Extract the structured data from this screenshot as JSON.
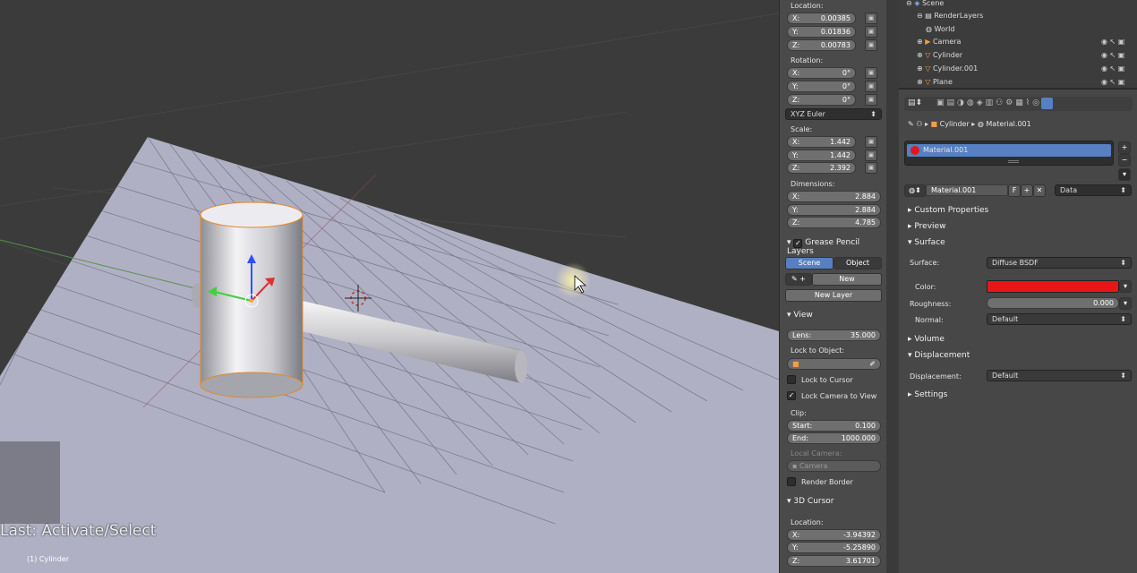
{
  "viewport": {
    "last_op": "Last: Activate/Select",
    "active_object": "(1) Cylinder"
  },
  "npanel": {
    "location_label": "Location:",
    "location": [
      {
        "axis": "X:",
        "value": "0.00385"
      },
      {
        "axis": "Y:",
        "value": "0.01836"
      },
      {
        "axis": "Z:",
        "value": "0.00783"
      }
    ],
    "rotation_label": "Rotation:",
    "rotation": [
      {
        "axis": "X:",
        "value": "0°"
      },
      {
        "axis": "Y:",
        "value": "0°"
      },
      {
        "axis": "Z:",
        "value": "0°"
      }
    ],
    "rotation_mode": "XYZ Euler",
    "scale_label": "Scale:",
    "scale": [
      {
        "axis": "X:",
        "value": "1.442"
      },
      {
        "axis": "Y:",
        "value": "1.442"
      },
      {
        "axis": "Z:",
        "value": "2.392"
      }
    ],
    "dimensions_label": "Dimensions:",
    "dimensions": [
      {
        "axis": "X:",
        "value": "2.884"
      },
      {
        "axis": "Y:",
        "value": "2.884"
      },
      {
        "axis": "Z:",
        "value": "4.785"
      }
    ],
    "grease_title": "Grease Pencil Layers",
    "grease_scene": "Scene",
    "grease_object": "Object",
    "grease_new": "New",
    "grease_new_layer": "New Layer",
    "view_title": "View",
    "lens_label": "Lens:",
    "lens_value": "35.000",
    "lock_to_object": "Lock to Object:",
    "lock_to_cursor": "Lock to Cursor",
    "lock_camera": "Lock Camera to View",
    "clip_label": "Clip:",
    "clip_start_label": "Start:",
    "clip_start": "0.100",
    "clip_end_label": "End:",
    "clip_end": "1000.000",
    "local_camera": "Local Camera:",
    "camera_field": "Camera",
    "render_border": "Render Border",
    "cursor_title": "3D Cursor",
    "cursor_location_label": "Location:",
    "cursor_location": [
      {
        "axis": "X:",
        "value": "-3.94392"
      },
      {
        "axis": "Y:",
        "value": "-5.25890"
      },
      {
        "axis": "Z:",
        "value": "3.61701"
      }
    ]
  },
  "outliner": {
    "items": [
      "Scene",
      "RenderLayers",
      "World",
      "Camera",
      "Cylinder",
      "Cylinder.001",
      "Plane"
    ]
  },
  "properties": {
    "breadcrumb_object": "Cylinder",
    "breadcrumb_material": "Material.001",
    "slot_name": "Material.001",
    "material_field": "Material.001",
    "material_f": "F",
    "link_mode": "Data",
    "sections": {
      "custom": "Custom Properties",
      "preview": "Preview",
      "surface": "Surface",
      "volume": "Volume",
      "displacement": "Displacement",
      "settings": "Settings"
    },
    "surface_label": "Surface:",
    "surface_value": "Diffuse BSDF",
    "color_label": "Color:",
    "color_hex": "#e8151b",
    "roughness_label": "Roughness:",
    "roughness_value": "0.000",
    "normal_label": "Normal:",
    "normal_value": "Default",
    "displacement_label": "Displacement:",
    "displacement_value": "Default"
  }
}
